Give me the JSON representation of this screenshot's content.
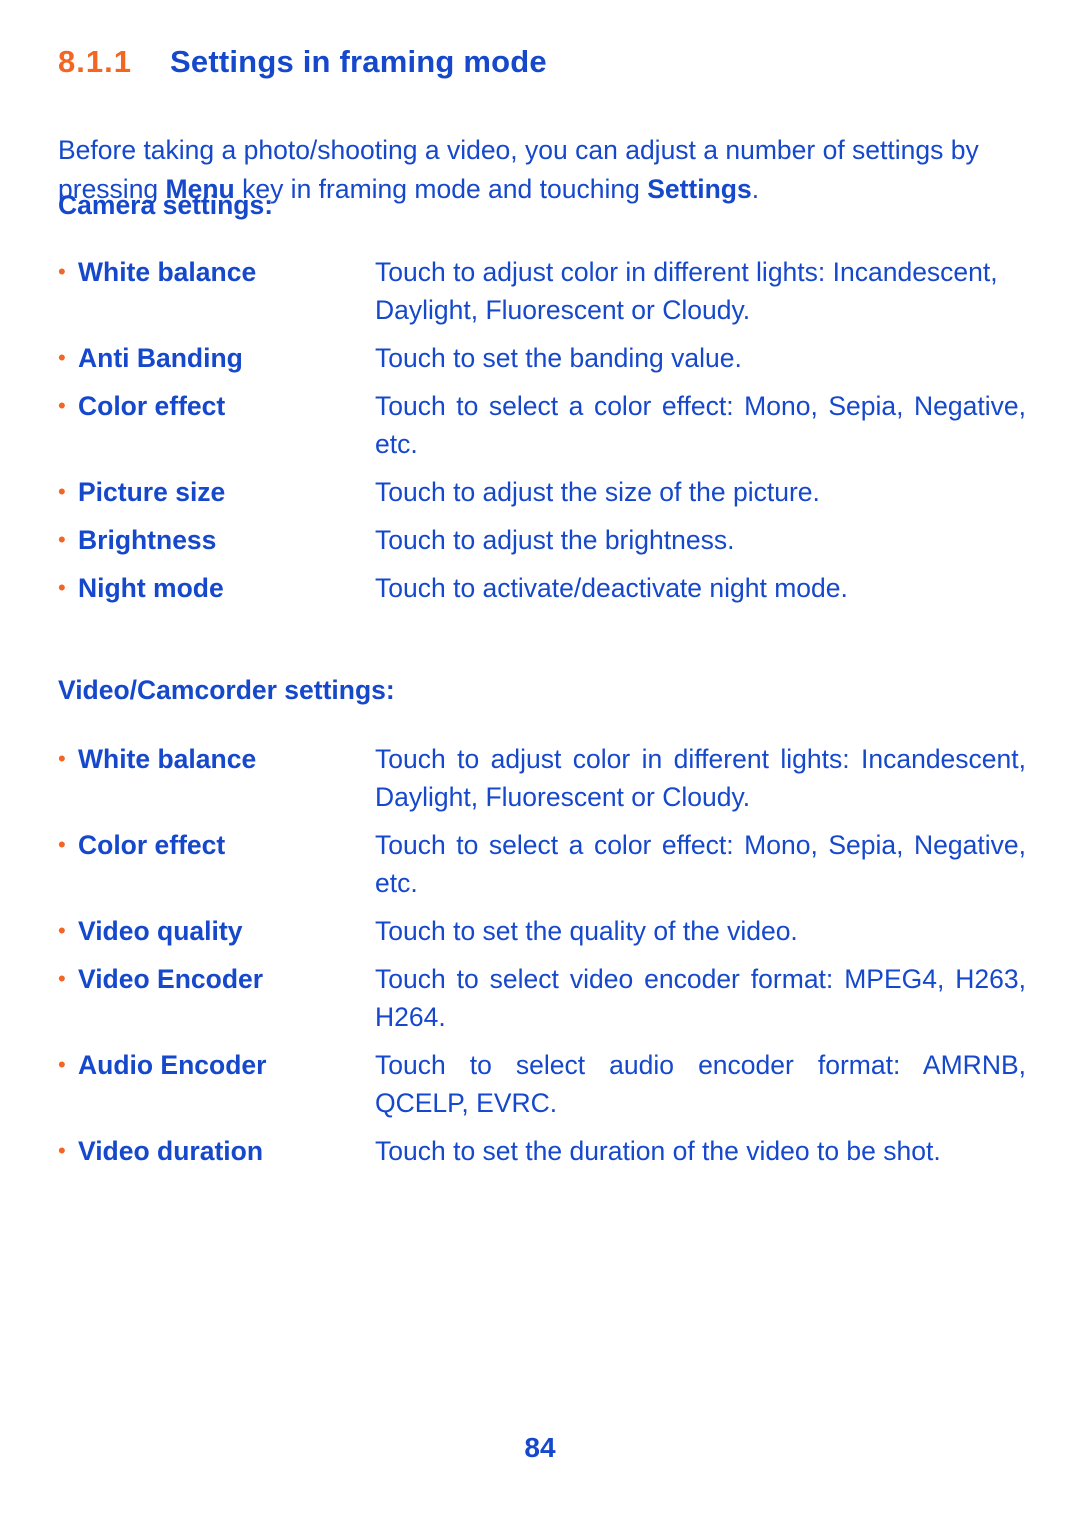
{
  "heading": {
    "number": "8.1.1",
    "title": "Settings in framing mode"
  },
  "intro": {
    "part1": "Before taking a photo/shooting a video, you can adjust a number of settings by pressing ",
    "bold1": "Menu",
    "part2": " key in framing mode and touching ",
    "bold2": "Settings",
    "part3": "."
  },
  "camera_section": {
    "heading": "Camera settings:",
    "items": [
      {
        "term": "White balance",
        "desc": "Touch to adjust color in different lights: Incandescent, Daylight, Fluorescent or Cloudy.",
        "justify": false
      },
      {
        "term": "Anti Banding",
        "desc": "Touch to set the banding value.",
        "justify": false
      },
      {
        "term": "Color effect",
        "desc": "Touch to select a color effect: Mono, Sepia, Negative, etc.",
        "justify": true
      },
      {
        "term": "Picture size",
        "desc": "Touch to adjust the size of the picture.",
        "justify": false
      },
      {
        "term": "Brightness",
        "desc": "Touch to adjust the brightness.",
        "justify": false
      },
      {
        "term": "Night mode",
        "desc": "Touch to activate/deactivate night mode.",
        "justify": false
      }
    ]
  },
  "video_section": {
    "heading": "Video/Camcorder settings:",
    "items": [
      {
        "term": "White balance",
        "desc": "Touch to adjust color in different lights: Incandescent, Daylight, Fluorescent or Cloudy.",
        "justify": true
      },
      {
        "term": "Color effect",
        "desc": "Touch to select a color effect: Mono, Sepia, Negative, etc.",
        "justify": true
      },
      {
        "term": "Video quality",
        "desc": "Touch to set the quality of the video.",
        "justify": false
      },
      {
        "term": "Video Encoder",
        "desc": "Touch to select video encoder format: MPEG4, H263, H264.",
        "justify": true
      },
      {
        "term": "Audio Encoder",
        "desc": "Touch to select audio encoder format: AMRNB, QCELP, EVRC.",
        "justify": true
      },
      {
        "term": "Video duration",
        "desc": "Touch to set the duration of the video to be shot.",
        "justify": false
      }
    ]
  },
  "bullet_glyph": "•",
  "page_number": "84",
  "colors": {
    "blue": "#1648cc",
    "orange": "#f26522"
  }
}
